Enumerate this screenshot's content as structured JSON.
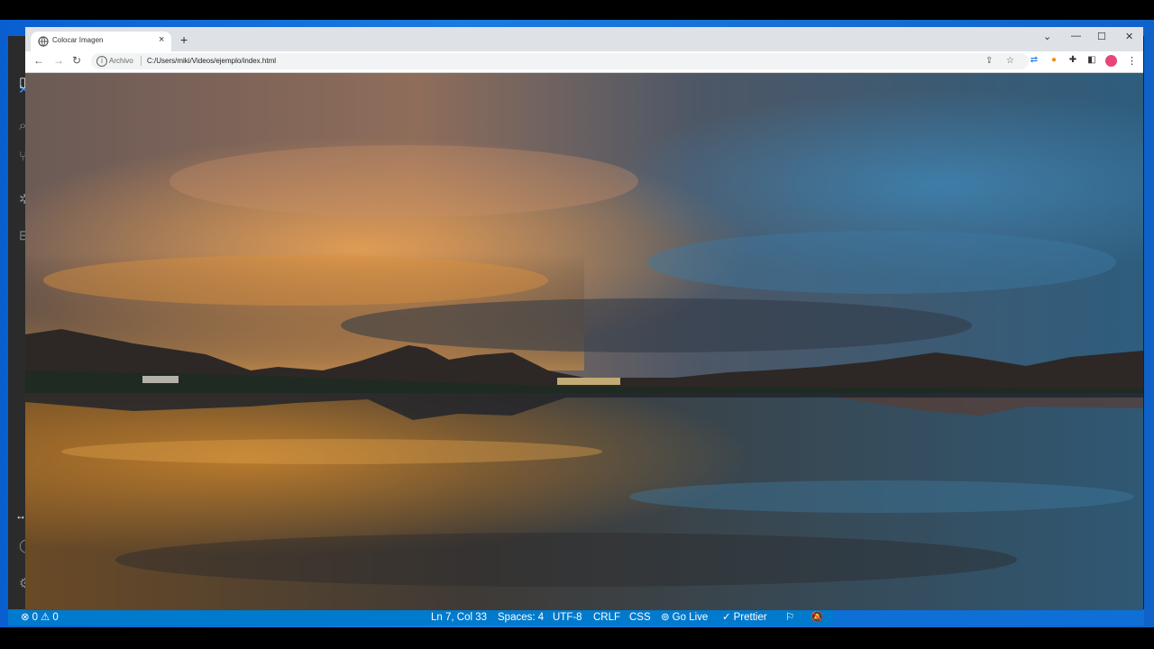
{
  "browser": {
    "tab_title": "Colocar Imagen",
    "tab_close": "×",
    "new_tab": "+",
    "origin_label": "Archivo",
    "url": "C:/Users/miki/Videos/ejemplo/index.html",
    "window_controls": {
      "chevron": "⌄",
      "minimize": "—",
      "maximize": "☐",
      "close": "✕"
    },
    "nav": {
      "back": "←",
      "forward": "→",
      "reload": "↻"
    },
    "image_alt": "Sunset landscape with mountains reflected in a lake"
  },
  "status_bar": {
    "errors": "0",
    "warnings": "0",
    "position": "Ln 7, Col 33",
    "spaces": "Spaces: 4",
    "encoding": "UTF-8",
    "eol": "CRLF",
    "language": "CSS",
    "go_live": "Go Live",
    "prettier": "Prettier"
  },
  "colors": {
    "status_bar": "#007acc",
    "tabstrip": "#dee1e6",
    "sky_orange": "#e39a3a",
    "sky_blue": "#2f6f9a"
  },
  "icons": [
    "error-icon",
    "warning-icon",
    "broadcast-icon",
    "check-double-icon",
    "feedback-icon",
    "bell-slash-icon",
    "globe-icon",
    "info-icon",
    "share-icon",
    "star-icon",
    "translate-icon",
    "extension-icon",
    "puzzle-icon",
    "sidebar-icon",
    "kebab-menu-icon"
  ]
}
